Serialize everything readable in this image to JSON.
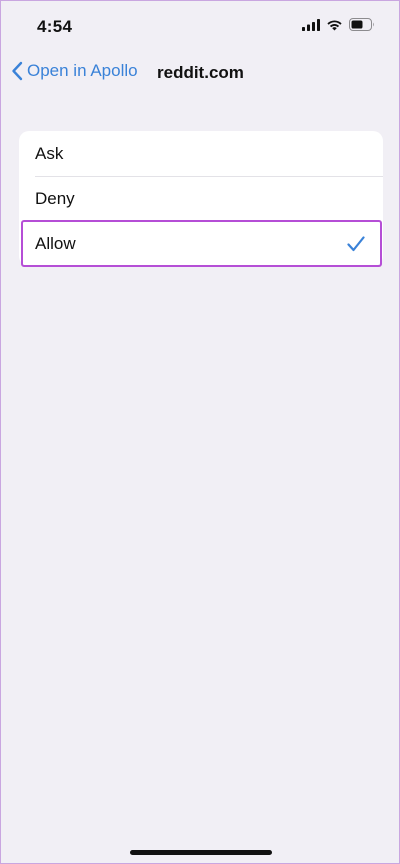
{
  "status_bar": {
    "time": "4:54",
    "icons": [
      "cellular-signal-icon",
      "wifi-icon",
      "battery-icon"
    ]
  },
  "nav": {
    "back_label": "Open in Apollo",
    "title": "reddit.com"
  },
  "options": [
    {
      "label": "Ask",
      "selected": false
    },
    {
      "label": "Deny",
      "selected": false
    },
    {
      "label": "Allow",
      "selected": true
    }
  ],
  "colors": {
    "accent": "#3a82d8",
    "background": "#f1eff5",
    "highlight": "#b54ed6"
  }
}
